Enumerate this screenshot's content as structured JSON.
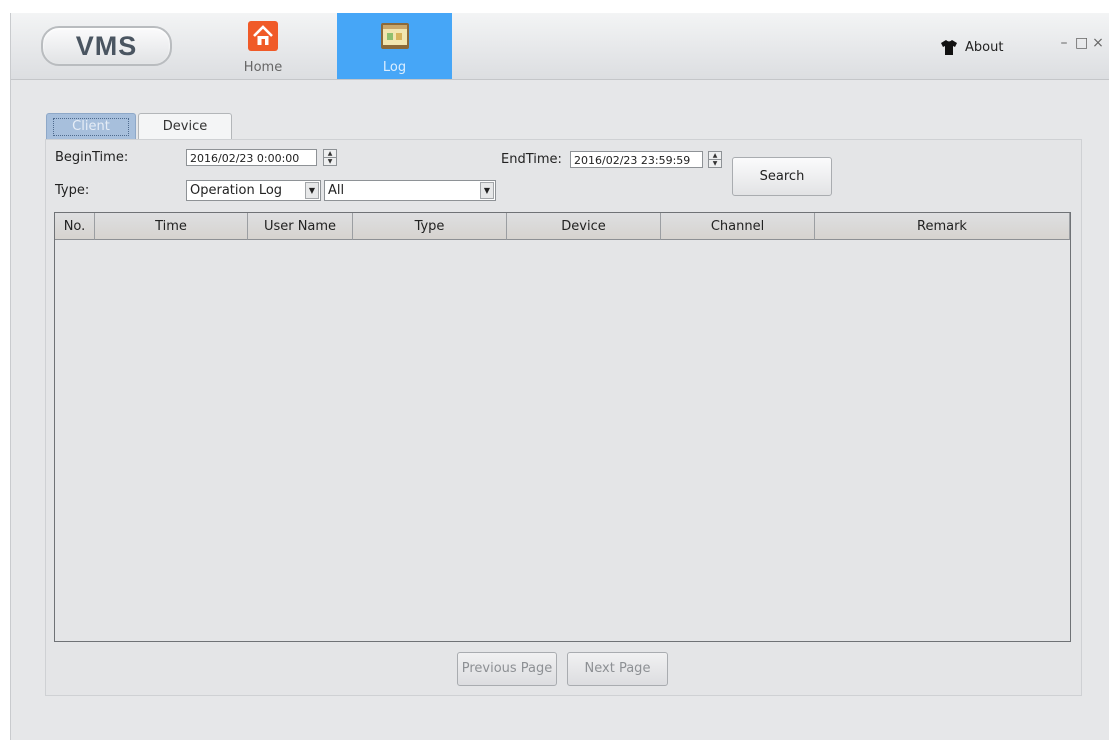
{
  "app": {
    "logo_text": "VMS"
  },
  "nav": {
    "home": {
      "label": "Home",
      "icon": "home-icon"
    },
    "log": {
      "label": "Log",
      "icon": "log-icon"
    }
  },
  "titlebar": {
    "about_label": "About",
    "about_icon": "shirt-icon"
  },
  "window_controls": {
    "minimize": "–",
    "maximize": "□",
    "close": "×"
  },
  "tabs": {
    "client": "Client",
    "device": "Device"
  },
  "filters": {
    "begin_label": "BeginTime:",
    "begin_value": "2016/02/23 0:00:00",
    "end_label": "EndTime:",
    "end_value": "2016/02/23 23:59:59",
    "type_label": "Type:",
    "type_value": "Operation Log",
    "subtype_value": "All",
    "search_label": "Search"
  },
  "table": {
    "columns": [
      "No.",
      "Time",
      "User Name",
      "Type",
      "Device",
      "Channel",
      "Remark"
    ],
    "rows": []
  },
  "pagination": {
    "prev": "Previous Page",
    "next": "Next Page"
  },
  "colors": {
    "active_nav": "#46a6f7",
    "home_icon": "#f05a28",
    "active_tab": "#a7bfdc"
  }
}
